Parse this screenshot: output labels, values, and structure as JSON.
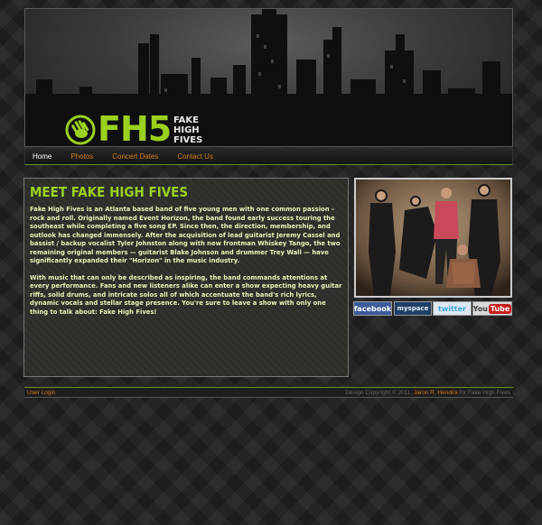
{
  "logo": {
    "mark": "FH5",
    "words": "FAKE\nHIGH\nFIVES"
  },
  "nav": {
    "items": [
      "Home",
      "Photos",
      "Concert Dates",
      "Contact Us"
    ]
  },
  "main": {
    "title": "MEET FAKE HIGH FIVES",
    "paragraphs": [
      "Fake High Fives is an Atlanta based band of five young men with one common passion – rock and roll. Originally named Event Horizon, the band found early success touring the southeast while completing a five song EP. Since then, the direction, membership, and outlook has changed immensely. After the acquisition of lead guitarist Jeremy Cassel and bassist / backup vocalist Tyler Johnston along with new frontman Whiskey Tango, the two remaining original members — guitarist Blake Johnson and drummer Trey Wall — have significantly expanded their \"Horizon\" in the music industry.",
      "With music that can only be described as inspiring, the band commands attentions at every performance. Fans and new listeners alike can enter a show expecting heavy guitar riffs, solid drums, and intricate solos all of which accentuate the band's rich lyrics, dynamic vocals and stellar stage presence. You're sure to leave a show with only one thing to talk about: Fake High Fives!"
    ]
  },
  "social": {
    "facebook": "facebook",
    "myspace": "myspace",
    "twitter": "twitter",
    "youtube_you": "You",
    "youtube_tube": "Tube"
  },
  "footer": {
    "login": "User Login",
    "credit_prefix": "Design Copyright © 2011,",
    "author": "Jaron R. Hendrix",
    "credit_suffix": "for Fake High Fives"
  },
  "colors": {
    "brand_green": "#9bd11f",
    "link_orange": "#d27a1c",
    "body_text": "#e7f5b8"
  }
}
